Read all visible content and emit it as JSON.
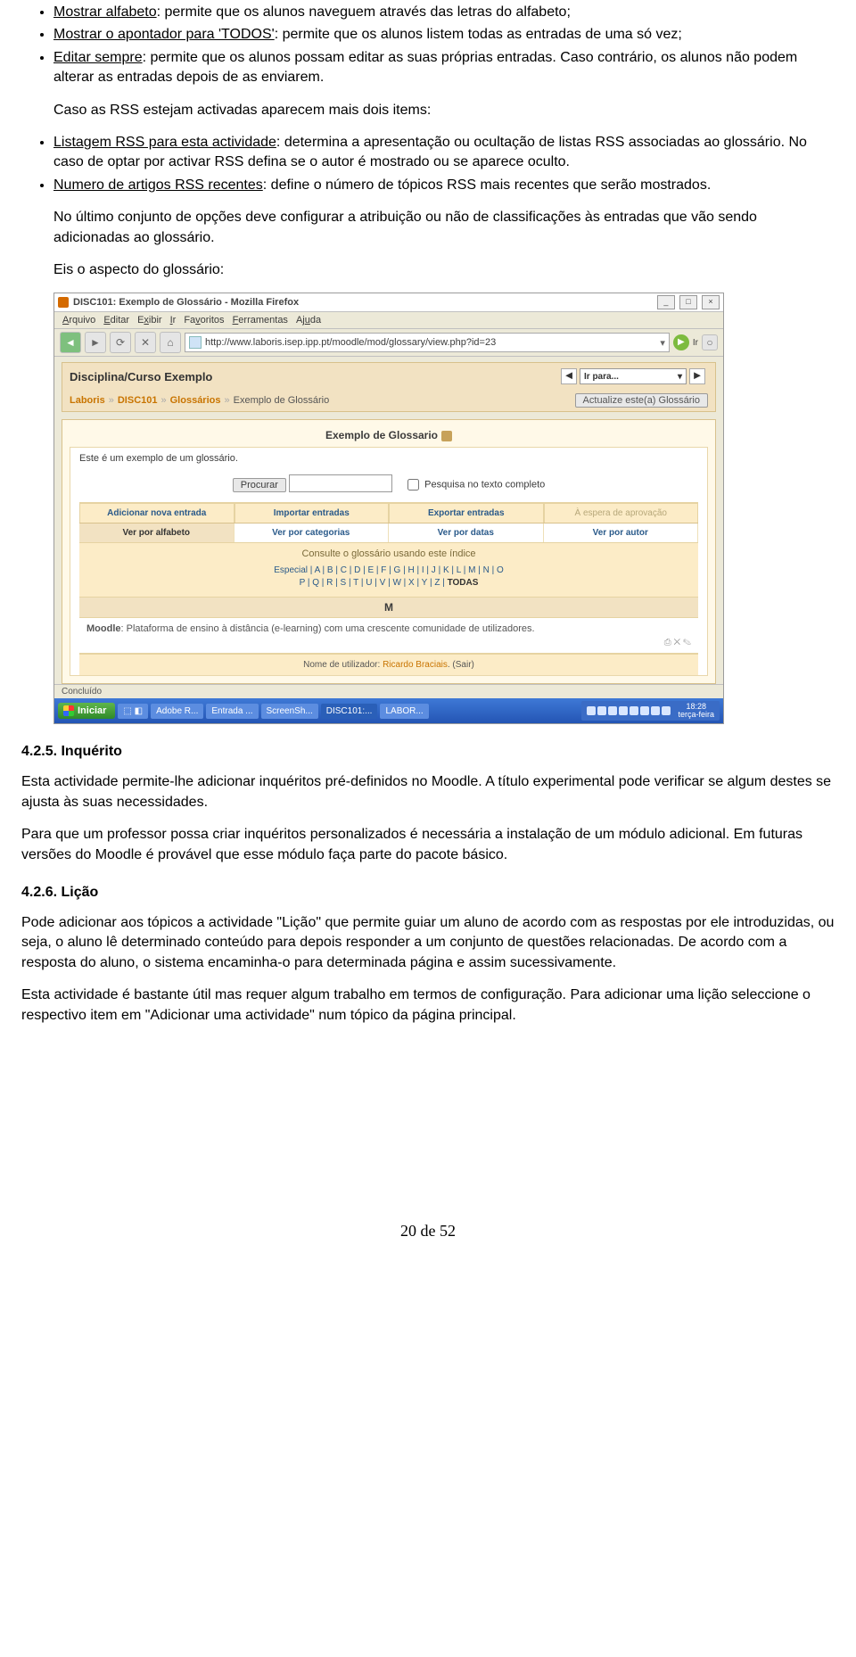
{
  "bullets1": [
    {
      "term": "Mostrar alfabeto",
      "rest": ": permite que os alunos naveguem através das letras do alfabeto;"
    },
    {
      "term": "Mostrar o apontador para 'TODOS'",
      "rest": ": permite que os alunos listem todas as entradas de uma só vez;"
    },
    {
      "term": "Editar sempre",
      "rest": ": permite que os alunos possam editar as suas próprias entradas. Caso contrário, os alunos não podem alterar as entradas depois de as enviarem."
    }
  ],
  "rss_intro": "Caso as RSS estejam activadas aparecem mais dois items:",
  "bullets2": [
    {
      "term": "Listagem RSS para esta actividade",
      "rest": ": determina a apresentação ou ocultação de listas RSS associadas ao glossário. No caso de optar por activar RSS defina se o autor é mostrado ou se aparece oculto."
    },
    {
      "term": "Numero de artigos RSS recentes",
      "rest": ": define o número de tópicos RSS mais recentes que serão mostrados."
    }
  ],
  "classificacoes_p": "No último conjunto de opções deve configurar a atribuição ou não de classificações às entradas que vão sendo adicionadas ao glossário.",
  "aspecto_p": "Eis o aspecto do glossário:",
  "shot": {
    "title": "DISC101: Exemplo de Glossário - Mozilla Firefox",
    "menus": [
      "Arquivo",
      "Editar",
      "Exibir",
      "Ir",
      "Favoritos",
      "Ferramentas",
      "Ajuda"
    ],
    "url": "http://www.laboris.isep.ipp.pt/moodle/mod/glossary/view.php?id=23",
    "go_label": "Ir",
    "course": "Disciplina/Curso Exemplo",
    "jump_label": "Ir para...",
    "crumbs": [
      "Laboris",
      "DISC101",
      "Glossários",
      "Exemplo de Glossário"
    ],
    "update_btn": "Actualize este(a) Glossário",
    "g_title": "Exemplo de Glossario",
    "g_desc": "Este é um exemplo de um glossário.",
    "search_btn": "Procurar",
    "fulltext": "Pesquisa no texto completo",
    "tabs": [
      "Adicionar nova entrada",
      "Importar entradas",
      "Exportar entradas",
      "À espera de aprovação"
    ],
    "tabs2": [
      "Ver por alfabeto",
      "Ver por categorias",
      "Ver por datas",
      "Ver por autor"
    ],
    "index_label": "Consulte o glossário usando este índice",
    "alpha_line1": "Especial | A | B | C | D | E | F | G | H | I | J | K | L | M | N | O",
    "alpha_line2_pre": "P | Q | R | S | T | U | V | W | X | Y | Z | ",
    "alpha_todas": "TODAS",
    "letter": "M",
    "entry_term": "Moodle",
    "entry_def": ": Plataforma de ensino à distância (e-learning) com uma crescente comunidade de utilizadores.",
    "entry_actions": "⎙ ✕ ✎",
    "user_line_pre": "Nome de utilizador: ",
    "user_name": "Ricardo Braciais",
    "user_sair": ". (Sair)",
    "statusbar": "Concluído",
    "tasks": {
      "start": "Iniciar",
      "items": [
        "Adobe R...",
        "Entrada ...",
        "ScreenSh...",
        "DISC101:...",
        "LABOR..."
      ],
      "clock_time": "18:28",
      "clock_day": "terça-feira"
    }
  },
  "inquerito": {
    "h": "4.2.5. Inquérito",
    "p1": "Esta actividade permite-lhe adicionar inquéritos pré-definidos no Moodle. A título experimental pode verificar se algum destes se ajusta às suas necessidades.",
    "p2": "Para que um professor possa criar inquéritos personalizados é necessária a instalação de um módulo adicional. Em futuras versões do Moodle é provável que esse módulo faça parte do pacote básico."
  },
  "licao": {
    "h": "4.2.6. Lição",
    "p1": "Pode adicionar aos tópicos a actividade \"Lição\" que permite guiar um aluno de acordo com as respostas por ele introduzidas, ou seja, o aluno lê determinado conteúdo para depois responder a um conjunto de questões relacionadas. De acordo com a resposta do aluno, o sistema encaminha-o para determinada página e assim sucessivamente.",
    "p2": "Esta actividade é bastante útil mas requer algum trabalho em termos de configuração. Para adicionar uma lição seleccione o respectivo item em \"Adicionar uma actividade\" num tópico da página principal."
  },
  "page_num": "20 de 52"
}
